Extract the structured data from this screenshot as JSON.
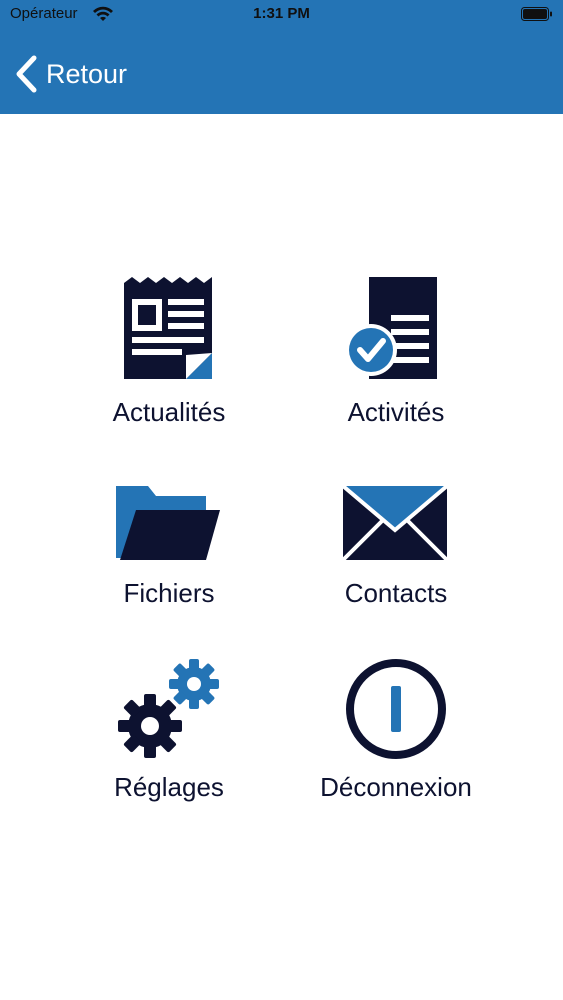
{
  "status_bar": {
    "carrier": "Opérateur",
    "time": "1:31 PM",
    "wifi_icon": "wifi-icon",
    "battery_icon": "battery-icon"
  },
  "nav": {
    "back_label": "Retour",
    "back_icon": "chevron-left-icon"
  },
  "colors": {
    "nav_background": "#2474b5",
    "icon_dark": "#0d1230",
    "icon_accent": "#2474b5",
    "page_background": "#ffffff"
  },
  "menu": {
    "items": [
      {
        "label": "Actualités",
        "icon": "newspaper-icon"
      },
      {
        "label": "Activités",
        "icon": "checklist-document-icon"
      },
      {
        "label": "Fichiers",
        "icon": "folder-icon"
      },
      {
        "label": "Contacts",
        "icon": "envelope-icon"
      },
      {
        "label": "Réglages",
        "icon": "gears-icon"
      },
      {
        "label": "Déconnexion",
        "icon": "power-icon"
      }
    ]
  }
}
